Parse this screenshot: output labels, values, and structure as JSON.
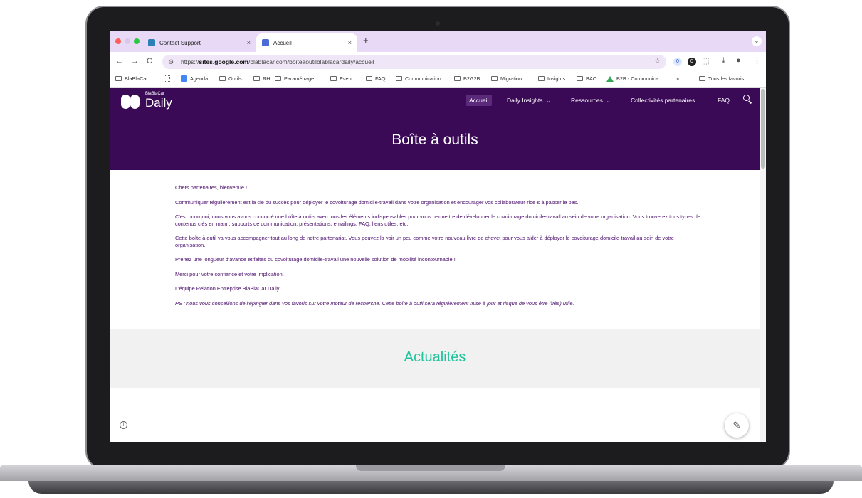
{
  "browser": {
    "tabs": [
      {
        "title": "Contact Support",
        "close": "×"
      },
      {
        "title": "Accueil",
        "close": "×"
      }
    ],
    "new_tab": "+",
    "tab_menu": "⌄",
    "nav": {
      "back": "←",
      "forward": "→",
      "reload": "C"
    },
    "url": {
      "prefix": "https://",
      "host": "sites.google.com",
      "path": "/blablacar.com/boiteaoutilblablacardaily/accueil"
    },
    "toolbar_icons": {
      "star": "☆",
      "ext1": "0",
      "ext2": "0",
      "puzzle": "⬚",
      "download": "⤓",
      "profile": "●",
      "menu": "⋮"
    },
    "bookmarks": [
      "BlaBlaCar",
      "Agenda",
      "Outils",
      "RH",
      "Paramétrage",
      "Event",
      "FAQ",
      "Communication",
      "B2G2B",
      "Migration",
      "Insights",
      "BAO",
      "B2B - Communica...",
      "Tous les favoris"
    ],
    "bookmarks_more": "»"
  },
  "site": {
    "logo": {
      "small": "BlaBlaCar",
      "big": "Daily"
    },
    "nav": [
      {
        "label": "Accueil",
        "dropdown": false
      },
      {
        "label": "Daily Insights",
        "dropdown": true
      },
      {
        "label": "Ressources",
        "dropdown": true
      },
      {
        "label": "Collectivités partenaires",
        "dropdown": false
      },
      {
        "label": "FAQ",
        "dropdown": false
      }
    ],
    "hero_title": "Boîte à outils",
    "paragraphs": [
      "Chers partenaires, bienvenue !",
      "Communiquer régulièrement est la clé du succès pour déployer le covoiturage domicile-travail dans votre organisation et encourager vos collaborateur·rice·s à passer le pas.",
      "C'est pourquoi, nous vous avons concocté une boîte à outils avec tous les éléments indispensables pour vous permettre de développer le covoiturage domicile-travail au sein de votre organisation. Vous trouverez tous types de contenus clés en main : supports de communication, présentations, emailings, FAQ, liens utiles, etc.",
      "Cette boîte à outil va vous accompagner tout au long de notre partenariat. Vous pouvez la voir un peu comme votre nouveau livre de chevet pour vous aider à déployer le covoiturage domicile-travail au sein de votre organisation.",
      "Prenez une longueur d'avance et faites du covoiturage domicile-travail une nouvelle solution de mobilité incontournable !",
      "Merci pour votre confiance et votre implication.",
      "L'équipe Relation Entreprise BlaBlaCar Daily"
    ],
    "ps": "PS : nous vous conseillons de l'épingler dans vos favoris sur votre moteur de recherche. Cette boîte à outil sera régulièrement mise à jour et risque de vous être (très) utile.",
    "news_title": "Actualités",
    "info_glyph": "i",
    "edit_glyph": "✎",
    "chevron_glyph": "⌄"
  },
  "colors": {
    "hero": "#3b0a57",
    "text": "#4a0e6b",
    "accent": "#1fc29a",
    "tabbar": "#e8daf6"
  }
}
